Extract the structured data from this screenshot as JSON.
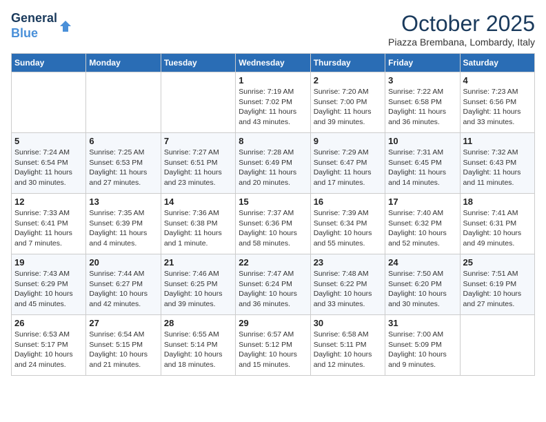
{
  "header": {
    "logo_line1": "General",
    "logo_line2": "Blue",
    "month": "October 2025",
    "location": "Piazza Brembana, Lombardy, Italy"
  },
  "days_of_week": [
    "Sunday",
    "Monday",
    "Tuesday",
    "Wednesday",
    "Thursday",
    "Friday",
    "Saturday"
  ],
  "weeks": [
    [
      {
        "num": "",
        "detail": ""
      },
      {
        "num": "",
        "detail": ""
      },
      {
        "num": "",
        "detail": ""
      },
      {
        "num": "1",
        "detail": "Sunrise: 7:19 AM\nSunset: 7:02 PM\nDaylight: 11 hours and 43 minutes."
      },
      {
        "num": "2",
        "detail": "Sunrise: 7:20 AM\nSunset: 7:00 PM\nDaylight: 11 hours and 39 minutes."
      },
      {
        "num": "3",
        "detail": "Sunrise: 7:22 AM\nSunset: 6:58 PM\nDaylight: 11 hours and 36 minutes."
      },
      {
        "num": "4",
        "detail": "Sunrise: 7:23 AM\nSunset: 6:56 PM\nDaylight: 11 hours and 33 minutes."
      }
    ],
    [
      {
        "num": "5",
        "detail": "Sunrise: 7:24 AM\nSunset: 6:54 PM\nDaylight: 11 hours and 30 minutes."
      },
      {
        "num": "6",
        "detail": "Sunrise: 7:25 AM\nSunset: 6:53 PM\nDaylight: 11 hours and 27 minutes."
      },
      {
        "num": "7",
        "detail": "Sunrise: 7:27 AM\nSunset: 6:51 PM\nDaylight: 11 hours and 23 minutes."
      },
      {
        "num": "8",
        "detail": "Sunrise: 7:28 AM\nSunset: 6:49 PM\nDaylight: 11 hours and 20 minutes."
      },
      {
        "num": "9",
        "detail": "Sunrise: 7:29 AM\nSunset: 6:47 PM\nDaylight: 11 hours and 17 minutes."
      },
      {
        "num": "10",
        "detail": "Sunrise: 7:31 AM\nSunset: 6:45 PM\nDaylight: 11 hours and 14 minutes."
      },
      {
        "num": "11",
        "detail": "Sunrise: 7:32 AM\nSunset: 6:43 PM\nDaylight: 11 hours and 11 minutes."
      }
    ],
    [
      {
        "num": "12",
        "detail": "Sunrise: 7:33 AM\nSunset: 6:41 PM\nDaylight: 11 hours and 7 minutes."
      },
      {
        "num": "13",
        "detail": "Sunrise: 7:35 AM\nSunset: 6:39 PM\nDaylight: 11 hours and 4 minutes."
      },
      {
        "num": "14",
        "detail": "Sunrise: 7:36 AM\nSunset: 6:38 PM\nDaylight: 11 hours and 1 minute."
      },
      {
        "num": "15",
        "detail": "Sunrise: 7:37 AM\nSunset: 6:36 PM\nDaylight: 10 hours and 58 minutes."
      },
      {
        "num": "16",
        "detail": "Sunrise: 7:39 AM\nSunset: 6:34 PM\nDaylight: 10 hours and 55 minutes."
      },
      {
        "num": "17",
        "detail": "Sunrise: 7:40 AM\nSunset: 6:32 PM\nDaylight: 10 hours and 52 minutes."
      },
      {
        "num": "18",
        "detail": "Sunrise: 7:41 AM\nSunset: 6:31 PM\nDaylight: 10 hours and 49 minutes."
      }
    ],
    [
      {
        "num": "19",
        "detail": "Sunrise: 7:43 AM\nSunset: 6:29 PM\nDaylight: 10 hours and 45 minutes."
      },
      {
        "num": "20",
        "detail": "Sunrise: 7:44 AM\nSunset: 6:27 PM\nDaylight: 10 hours and 42 minutes."
      },
      {
        "num": "21",
        "detail": "Sunrise: 7:46 AM\nSunset: 6:25 PM\nDaylight: 10 hours and 39 minutes."
      },
      {
        "num": "22",
        "detail": "Sunrise: 7:47 AM\nSunset: 6:24 PM\nDaylight: 10 hours and 36 minutes."
      },
      {
        "num": "23",
        "detail": "Sunrise: 7:48 AM\nSunset: 6:22 PM\nDaylight: 10 hours and 33 minutes."
      },
      {
        "num": "24",
        "detail": "Sunrise: 7:50 AM\nSunset: 6:20 PM\nDaylight: 10 hours and 30 minutes."
      },
      {
        "num": "25",
        "detail": "Sunrise: 7:51 AM\nSunset: 6:19 PM\nDaylight: 10 hours and 27 minutes."
      }
    ],
    [
      {
        "num": "26",
        "detail": "Sunrise: 6:53 AM\nSunset: 5:17 PM\nDaylight: 10 hours and 24 minutes."
      },
      {
        "num": "27",
        "detail": "Sunrise: 6:54 AM\nSunset: 5:15 PM\nDaylight: 10 hours and 21 minutes."
      },
      {
        "num": "28",
        "detail": "Sunrise: 6:55 AM\nSunset: 5:14 PM\nDaylight: 10 hours and 18 minutes."
      },
      {
        "num": "29",
        "detail": "Sunrise: 6:57 AM\nSunset: 5:12 PM\nDaylight: 10 hours and 15 minutes."
      },
      {
        "num": "30",
        "detail": "Sunrise: 6:58 AM\nSunset: 5:11 PM\nDaylight: 10 hours and 12 minutes."
      },
      {
        "num": "31",
        "detail": "Sunrise: 7:00 AM\nSunset: 5:09 PM\nDaylight: 10 hours and 9 minutes."
      },
      {
        "num": "",
        "detail": ""
      }
    ]
  ]
}
